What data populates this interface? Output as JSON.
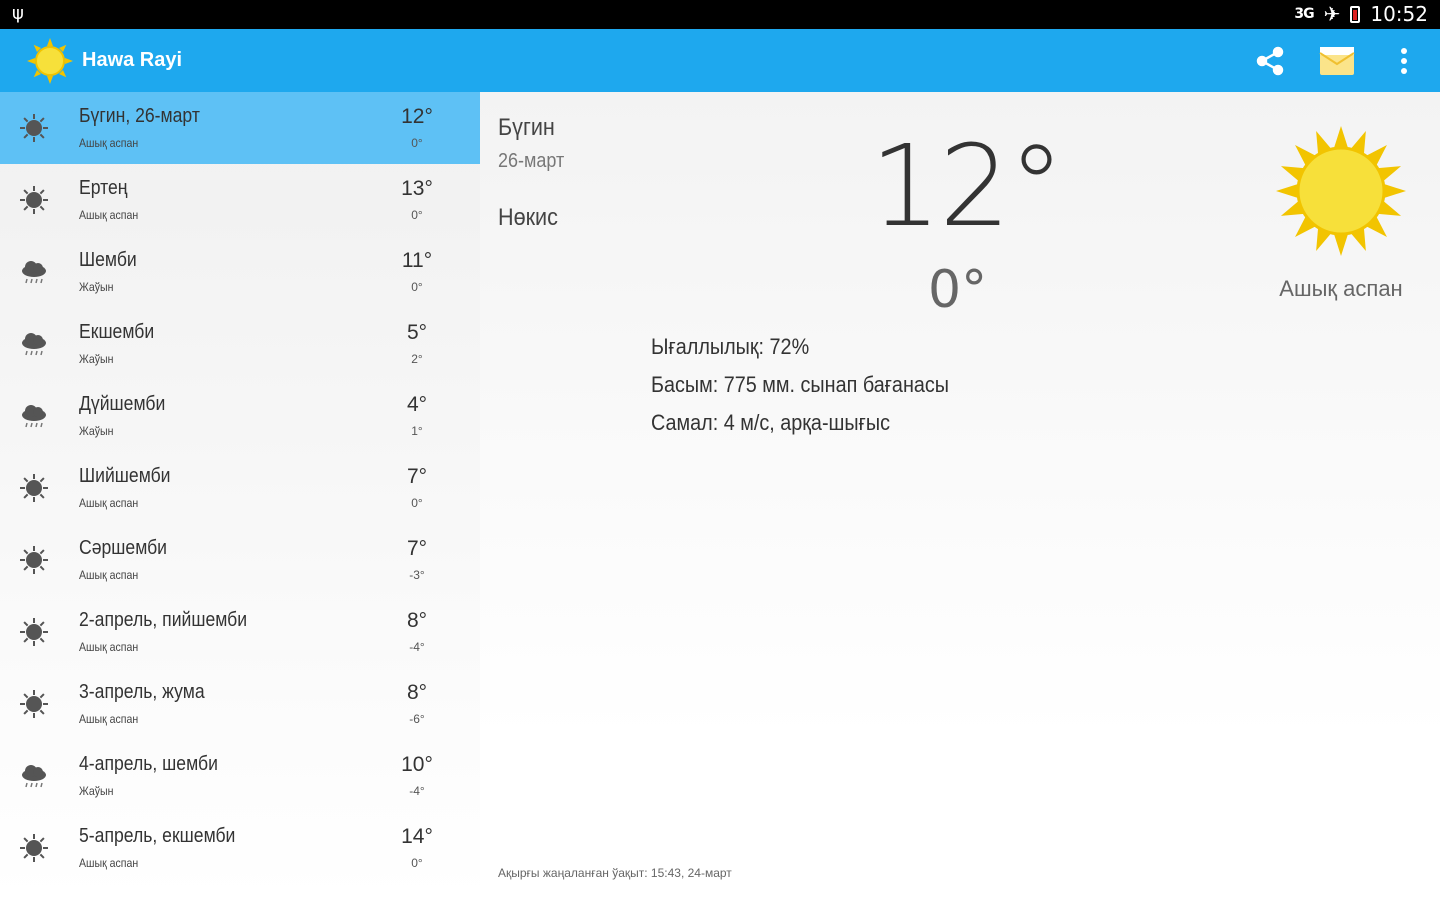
{
  "status_bar": {
    "time": "10:52",
    "network": "3G"
  },
  "app": {
    "title": "Hawa Rayi"
  },
  "forecast": [
    {
      "day": "Бүгин, 26-март",
      "condition": "Ашық аспан",
      "high": "12°",
      "low": "0°",
      "icon": "sun-icon",
      "selected": true
    },
    {
      "day": "Ертең",
      "condition": "Ашық аспан",
      "high": "13°",
      "low": "0°",
      "icon": "sun-icon"
    },
    {
      "day": "Шемби",
      "condition": "Жаўын",
      "high": "11°",
      "low": "0°",
      "icon": "rain-icon"
    },
    {
      "day": "Екшемби",
      "condition": "Жаўын",
      "high": "5°",
      "low": "2°",
      "icon": "rain-icon"
    },
    {
      "day": "Дүйшемби",
      "condition": "Жаўын",
      "high": "4°",
      "low": "1°",
      "icon": "rain-icon"
    },
    {
      "day": "Шийшемби",
      "condition": "Ашық аспан",
      "high": "7°",
      "low": "0°",
      "icon": "sun-icon"
    },
    {
      "day": "Сәршемби",
      "condition": "Ашық аспан",
      "high": "7°",
      "low": "-3°",
      "icon": "sun-icon"
    },
    {
      "day": "2-апрель, пийшемби",
      "condition": "Ашық аспан",
      "high": "8°",
      "low": "-4°",
      "icon": "sun-icon"
    },
    {
      "day": "3-апрель, жума",
      "condition": "Ашық аспан",
      "high": "8°",
      "low": "-6°",
      "icon": "sun-icon"
    },
    {
      "day": "4-апрель, шемби",
      "condition": "Жаўын",
      "high": "10°",
      "low": "-4°",
      "icon": "rain-icon"
    },
    {
      "day": "5-апрель, екшемби",
      "condition": "Ашық аспан",
      "high": "14°",
      "low": "0°",
      "icon": "sun-icon"
    }
  ],
  "detail": {
    "today": "Бүгин",
    "date": "26-март",
    "city": "Нөкис",
    "high": "12°",
    "low": "0°",
    "condition": "Ашық аспан",
    "humidity": "Ығаллылық: 72%",
    "pressure": "Басым: 775 мм. сынап бағанасы",
    "wind": "Самал: 4 м/с, арқа-шығыс",
    "updated": "Ақырғы жаңаланған ўақыт: 15:43, 24-март"
  },
  "colors": {
    "action_bar": "#1ea8ee",
    "selected_row": "#5ec1f5",
    "sun": "#f5d020"
  }
}
